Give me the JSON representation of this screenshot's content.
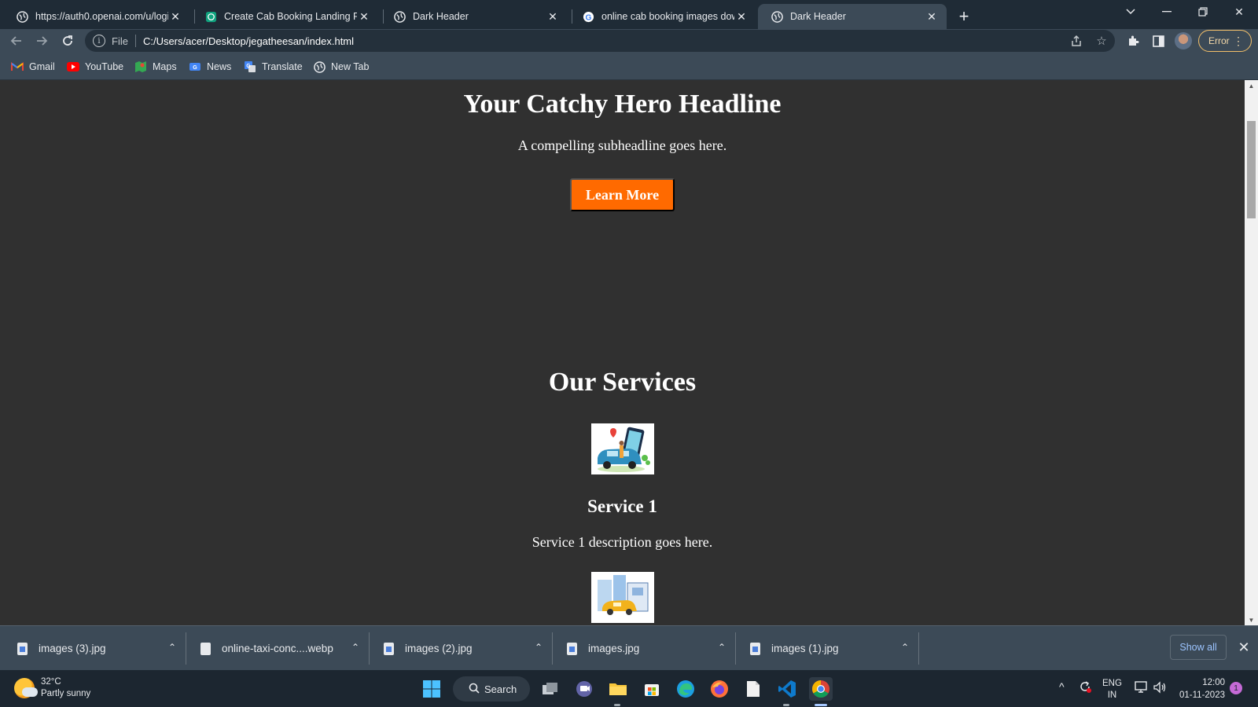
{
  "browser": {
    "tabs": [
      {
        "title": "https://auth0.openai.com/u/login",
        "active": false
      },
      {
        "title": "Create Cab Booking Landing Page",
        "active": false
      },
      {
        "title": "Dark Header",
        "active": false
      },
      {
        "title": "online cab booking images download",
        "active": false
      },
      {
        "title": "Dark Header",
        "active": true
      }
    ],
    "omnibox": {
      "scheme_label": "File",
      "url": "C:/Users/acer/Desktop/jegatheesan/index.html"
    },
    "profile_status": "Error",
    "bookmarks": [
      "Gmail",
      "YouTube",
      "Maps",
      "News",
      "Translate",
      "New Tab"
    ]
  },
  "page": {
    "hero": {
      "headline": "Your Catchy Hero Headline",
      "subheadline": "A compelling subheadline goes here.",
      "cta": "Learn More"
    },
    "services": {
      "title": "Our Services",
      "items": [
        {
          "name": "Service 1",
          "description": "Service 1 description goes here."
        }
      ]
    }
  },
  "downloads": {
    "items": [
      "images (3).jpg",
      "online-taxi-conc....webp",
      "images (2).jpg",
      "images.jpg",
      "images (1).jpg"
    ],
    "show_all": "Show all"
  },
  "taskbar": {
    "weather": {
      "temp": "32°C",
      "condition": "Partly sunny"
    },
    "search": "Search",
    "language": {
      "lang": "ENG",
      "region": "IN"
    },
    "clock": {
      "time": "12:00",
      "date": "01-11-2023"
    },
    "notification_count": "1"
  },
  "colors": {
    "accent_button": "#ff6a00",
    "page_bg": "#303030",
    "chrome_bg": "#3c4a57"
  }
}
